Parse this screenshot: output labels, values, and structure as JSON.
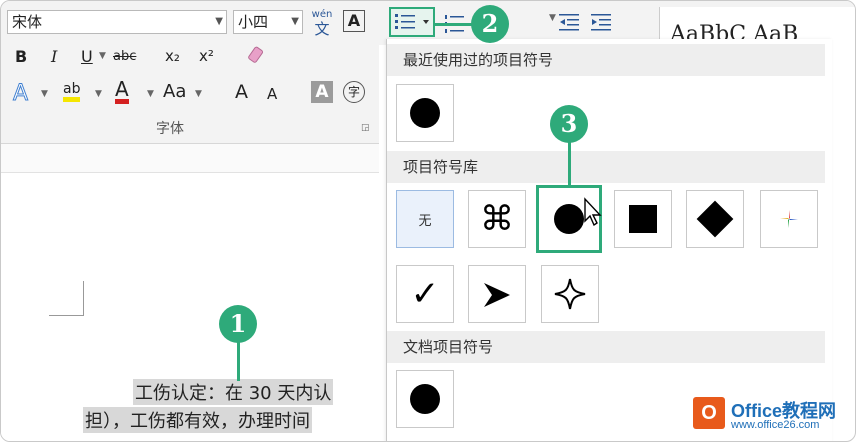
{
  "ribbon": {
    "font_name": "宋体",
    "font_size": "小四",
    "phonetic_guide_label": "wén",
    "phonetic_guide_char": "文",
    "char_border": "A",
    "bold": "B",
    "italic": "I",
    "underline": "U",
    "strikethrough": "abc",
    "subscript": "x₂",
    "superscript": "x²",
    "text_effects": "A",
    "highlight": "ab",
    "font_color": "A",
    "change_case": "Aa",
    "grow_font": "A",
    "shrink_font": "A",
    "char_shading": "A",
    "enclose_char": "字",
    "group_label": "字体",
    "styles_preview": "AaBbC AaB"
  },
  "panel": {
    "recent_header": "最近使用过的项目符号",
    "library_header": "项目符号库",
    "document_header": "文档项目符号",
    "none_label": "无",
    "library_tiles": [
      "none",
      "command-symbol",
      "filled-circle",
      "filled-square",
      "filled-diamond",
      "multicolor-star",
      "checkmark",
      "arrowhead",
      "four-point-star"
    ]
  },
  "document": {
    "line1": "工伤认定：在 30 天内认",
    "line2": "担），工伤都有效，办理时间"
  },
  "callouts": [
    "1",
    "2",
    "3"
  ],
  "watermark": {
    "logo_letter": "O",
    "title": "Office教程网",
    "url": "www.office26.com"
  },
  "colors": {
    "accent": "#2eaa7a",
    "font_color_red": "#d42020",
    "highlight_yellow": "#f5e600",
    "watermark_blue": "#1f6fb8",
    "watermark_orange": "#e85a1b"
  }
}
